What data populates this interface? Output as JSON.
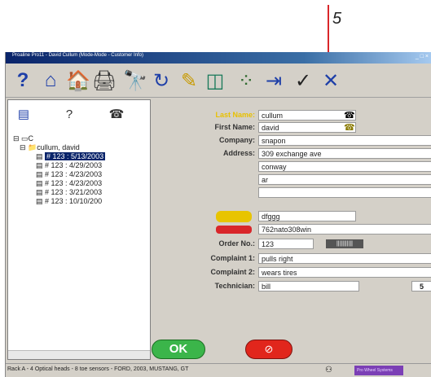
{
  "callout": {
    "number": "5"
  },
  "window": {
    "title": "Proaline Pro11 - David Cullum (Mode-Mode - Customer Info)",
    "controls": "_ □ ×"
  },
  "toolbar": {
    "buttons": [
      {
        "name": "help-icon",
        "glyph": "?"
      },
      {
        "name": "home-icon",
        "glyph": "⌂"
      },
      {
        "name": "customer-icon",
        "glyph": "🏠"
      },
      {
        "name": "print-icon",
        "glyph": "🖨"
      },
      {
        "name": "binoculars-icon",
        "glyph": "🔭"
      },
      {
        "name": "refresh-icon",
        "glyph": "↻"
      },
      {
        "name": "edit-icon",
        "glyph": "✎"
      },
      {
        "name": "chart-icon",
        "glyph": "◫"
      },
      {
        "name": "dots-icon",
        "glyph": "⁘"
      },
      {
        "name": "export-icon",
        "glyph": "⇥"
      },
      {
        "name": "check-icon",
        "glyph": "✓"
      },
      {
        "name": "close-icon",
        "glyph": "✕"
      }
    ]
  },
  "left_pane": {
    "icons": [
      {
        "name": "customers-icon",
        "glyph": "▤"
      },
      {
        "name": "help-tree-icon",
        "glyph": "?"
      },
      {
        "name": "phone-tree-icon",
        "glyph": "☎"
      }
    ],
    "tree": {
      "root": "C",
      "customer": "cullum, david",
      "records": [
        "# 123 : 5/13/2003",
        "# 123 : 4/29/2003",
        "# 123 : 4/23/2003",
        "# 123 : 4/23/2003",
        "# 123 : 3/21/2003",
        "# 123 : 10/10/200"
      ]
    }
  },
  "form": {
    "last_name": {
      "label": "Last Name:",
      "value": "cullum"
    },
    "first_name": {
      "label": "First Name:",
      "value": "david"
    },
    "company": {
      "label": "Company:",
      "value": "snapon"
    },
    "address": {
      "label": "Address:",
      "line1": "309 exchange ave",
      "line2": "conway",
      "line3": "ar",
      "line4": ""
    },
    "vehicle": {
      "value": "dfggg"
    },
    "vin": {
      "value": "762nato308win"
    },
    "order_no": {
      "label": "Order No.:",
      "value": "123",
      "barcode": "|||||||||||"
    },
    "complaint1": {
      "label": "Complaint 1:",
      "value": "pulls right"
    },
    "complaint2": {
      "label": "Complaint 2:",
      "value": "wears tires"
    },
    "technician": {
      "label": "Technician:",
      "value": "bill",
      "code": "5"
    },
    "ok_label": "OK",
    "cancel_label": "⊘"
  },
  "status": {
    "text": "Rack A - 4 Optical heads - 8 toe sensors - FORD, 2003, MUSTANG, GT",
    "brand": "Pro Wheel Systems"
  },
  "colors": {
    "titlebar": "#0a246a",
    "ok": "#3bb54a",
    "cancel": "#e1261c",
    "label_highlight": "#e8c000"
  }
}
